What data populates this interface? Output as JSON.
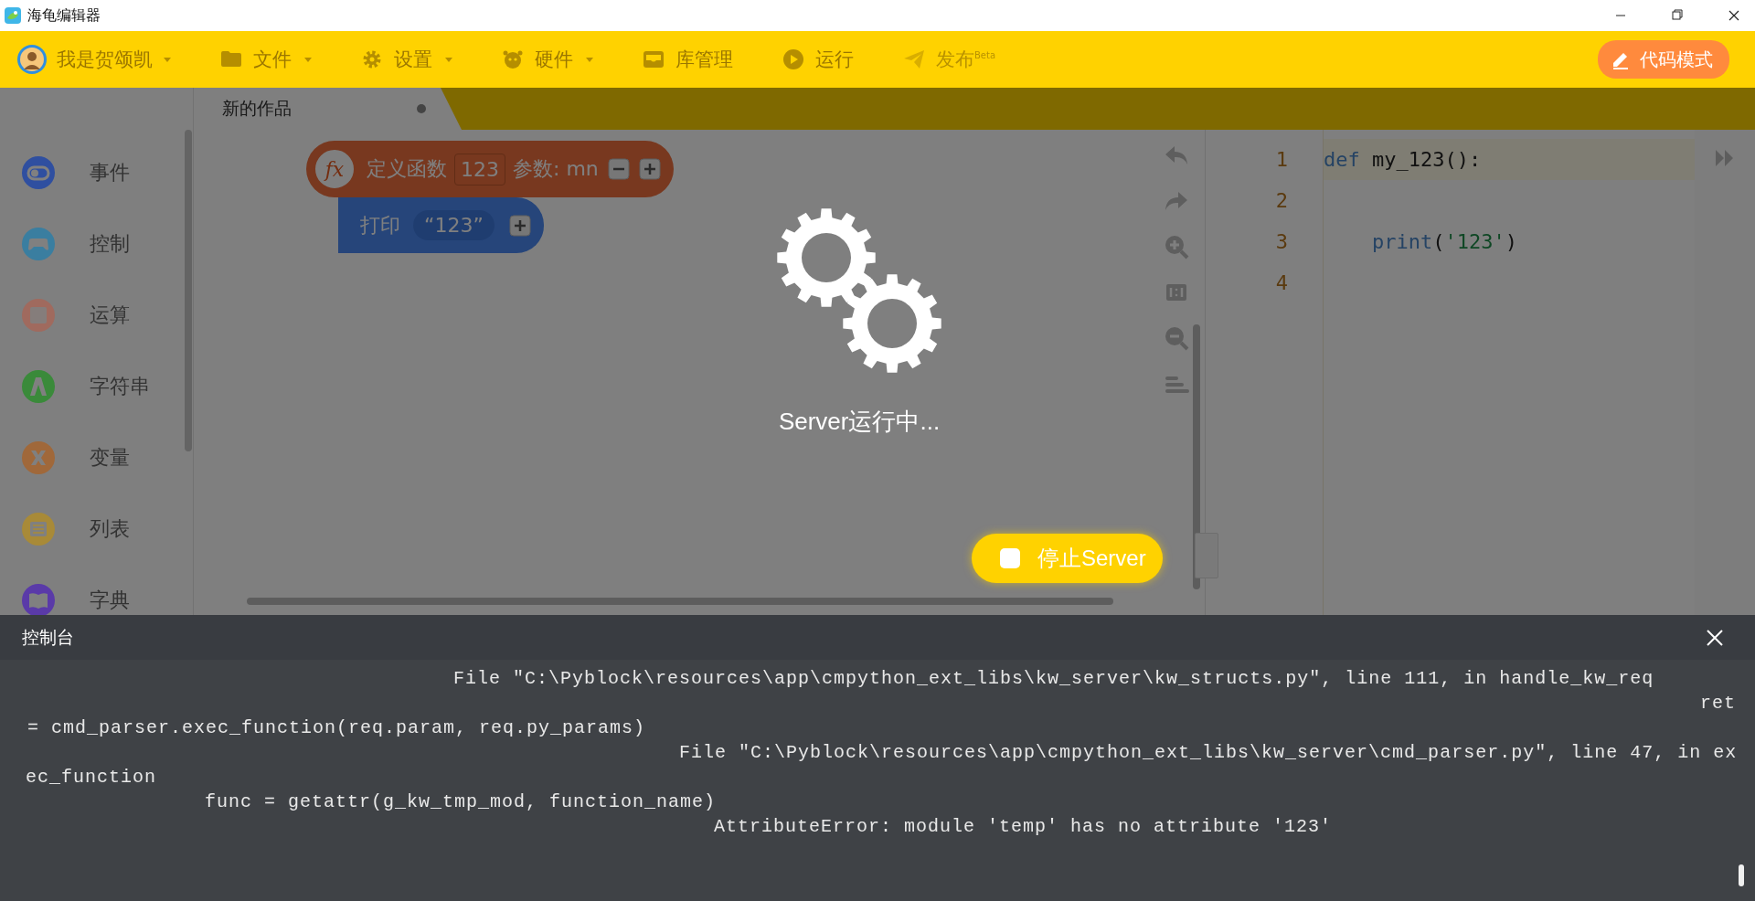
{
  "window": {
    "title": "海龟编辑器"
  },
  "toolbar": {
    "user": {
      "name": "我是贺颂凯"
    },
    "menus": [
      {
        "label": "文件",
        "kind": "dropdown"
      },
      {
        "label": "设置",
        "kind": "dropdown"
      },
      {
        "label": "硬件",
        "kind": "dropdown"
      },
      {
        "label": "库管理",
        "kind": "button"
      },
      {
        "label": "运行",
        "kind": "button"
      },
      {
        "label": "发布$^{Beta}$",
        "kind": "button"
      }
    ],
    "mode_button": {
      "label": "代码模式"
    }
  },
  "tabs": [
    {
      "label": "新的作品",
      "selected": true,
      "unsaved": true
    }
  ],
  "categories": [
    {
      "label": "事件",
      "color": "#2f4fa0"
    },
    {
      "label": "控制",
      "color": "#3a7ea0"
    },
    {
      "label": "运算",
      "color": "#a06a5e"
    },
    {
      "label": "字符串",
      "color": "#3a8a3a"
    },
    {
      "label": "变量",
      "color": "#a0683a"
    },
    {
      "label": "列表",
      "color": "#a88a38"
    },
    {
      "label": "字典",
      "color": "#5a3aa8"
    }
  ],
  "blocks": [
    {
      "kind": "define",
      "symbol": "fx",
      "label": "定义函数",
      "name": "123",
      "params": "参数: mn"
    },
    {
      "kind": "print",
      "label": "打印",
      "value": "“123”"
    }
  ],
  "code": {
    "lines": [
      {
        "number": "1",
        "active": true,
        "tokens": [
          {
            "kind": "keyword",
            "text": "def"
          },
          {
            "kind": "plain",
            "text": " my_123():"
          }
        ]
      },
      {
        "number": "2",
        "active": false
      },
      {
        "number": "3",
        "active": false,
        "indented": true,
        "tokens": [
          {
            "kind": "keyword",
            "text": "print"
          },
          {
            "kind": "plain",
            "text": "("
          },
          {
            "kind": "string",
            "text": "'123'"
          },
          {
            "kind": "plain",
            "text": ")"
          }
        ]
      },
      {
        "number": "4",
        "active": false
      }
    ]
  },
  "overlay": {
    "status": "Server运行中...",
    "stop_button": "停止Server"
  },
  "console": {
    "title": "控制台",
    "lines": [
      "File \"C:\\Pyblock\\resources\\app\\cmpython_ext_libs\\kw_server\\kw_structs.py\", line 111, in handle_kw_req",
      "ret",
      "= cmd_parser.exec_function(req.param, req.py_params)",
      "File \"C:\\Pyblock\\resources\\app\\cmpython_ext_libs\\kw_server\\cmd_parser.py\", line 47, in ex",
      "ec_function",
      "func = getattr(g_kw_tmp_mod, function_name)",
      "AttributeError: module 'temp' has no attribute '123'"
    ]
  }
}
